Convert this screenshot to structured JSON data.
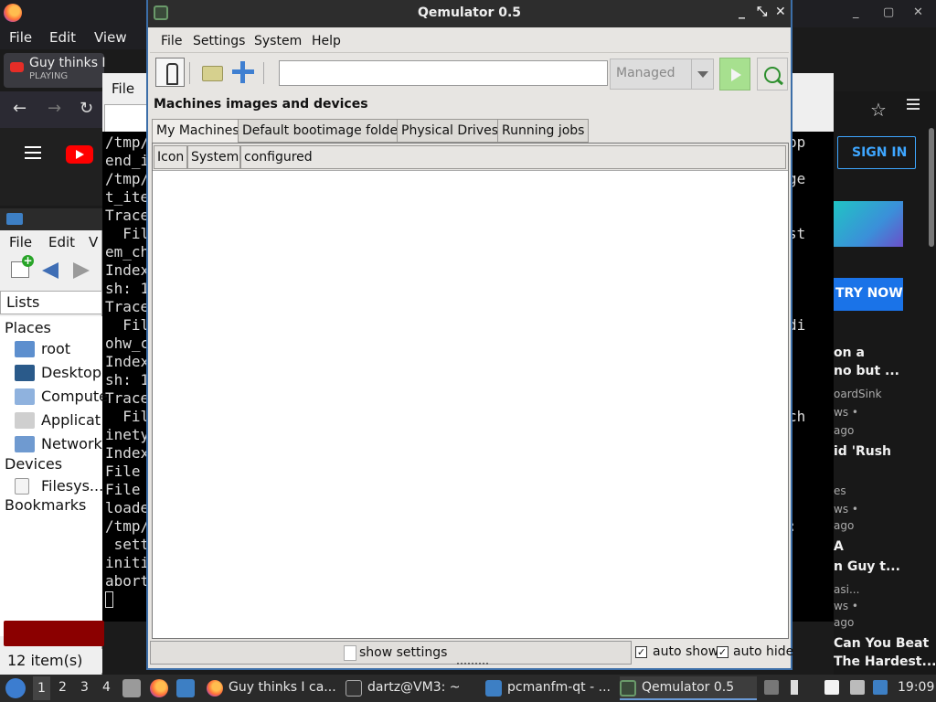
{
  "firefox": {
    "menu": [
      "File",
      "Edit",
      "View"
    ],
    "tab_title": "Guy thinks I",
    "tab_status": "PLAYING",
    "window_controls": [
      "_",
      "▢",
      "✕"
    ]
  },
  "youtube": {
    "sign_in": "SIGN IN",
    "try_now": "TRY NOW",
    "items": [
      {
        "title": "on a",
        "sub": ""
      },
      {
        "title": "no but ...",
        "sub": ""
      },
      {
        "title": "",
        "sub": "oardSink"
      },
      {
        "title": "",
        "sub": "ws •"
      },
      {
        "title": "",
        "sub": "ago"
      },
      {
        "title": "id 'Rush",
        "sub": ""
      },
      {
        "title": "",
        "sub": "es"
      },
      {
        "title": "",
        "sub": "ws •"
      },
      {
        "title": "",
        "sub": "ago"
      },
      {
        "title": "A",
        "sub": ""
      },
      {
        "title": "n Guy t...",
        "sub": ""
      },
      {
        "title": "",
        "sub": "asi..."
      },
      {
        "title": "",
        "sub": "ws •"
      },
      {
        "title": "",
        "sub": "ago"
      },
      {
        "title": "Can You Beat",
        "sub": ""
      },
      {
        "title": "The Hardest...",
        "sub": ""
      }
    ]
  },
  "pcmanfm": {
    "menu": [
      "File",
      "Edit",
      "V"
    ],
    "lists_label": "Lists",
    "places_label": "Places",
    "places": [
      "root",
      "Desktop",
      "Compute",
      "Applicat",
      "Network"
    ],
    "devices_label": "Devices",
    "devices": [
      "Filesys..."
    ],
    "bookmarks_label": "Bookmarks",
    "status": "12 item(s)"
  },
  "terminal": {
    "menu_file": "File",
    "lines_left": [
      "/tmp/",
      "end_i",
      "/tmp/",
      "t_ite",
      "Trace",
      "  Fil",
      "em_ch",
      "Index",
      "sh: 1",
      "Trace",
      "  Fil",
      "ohw_c",
      "Index",
      "sh: 1",
      "Trace",
      "  Fil",
      "inety",
      "Index",
      "File",
      "File",
      "loade",
      "/tmp/",
      " sett",
      "initi",
      "abort"
    ],
    "lines_right": [
      "pp",
      "",
      "ge",
      "",
      "",
      "st",
      "",
      "",
      "",
      "",
      "di",
      "",
      "",
      "",
      "",
      "ch",
      "",
      "",
      "",
      "",
      "",
      ":"
    ]
  },
  "qemulator": {
    "title": "Qemulator 0.5",
    "window_controls": [
      "_",
      "⤡",
      "✕"
    ],
    "menu": [
      {
        "label": "File"
      },
      {
        "label": "Settings"
      },
      {
        "label": "System"
      },
      {
        "label": "Help"
      }
    ],
    "command_value": "",
    "mode_select": "Managed",
    "section_title": "Machines images and devices",
    "tabs": [
      "My Machines",
      "Default bootimage folder",
      "Physical Drives",
      "Running jobs"
    ],
    "columns": [
      "Icon",
      "System",
      "configured"
    ],
    "rows": [],
    "show_settings": "show settings",
    "auto_show": "auto show",
    "auto_hide": "auto hide",
    "auto_show_checked": true,
    "auto_hide_checked": true
  },
  "taskbar": {
    "workspaces": [
      "1",
      "2",
      "3",
      "4"
    ],
    "tasks": [
      {
        "label": "Guy thinks I ca..."
      },
      {
        "label": "dartz@VM3: ~"
      },
      {
        "label": "pcmanfm-qt - ..."
      },
      {
        "label": "Qemulator 0.5"
      }
    ],
    "clock": "19:09"
  }
}
